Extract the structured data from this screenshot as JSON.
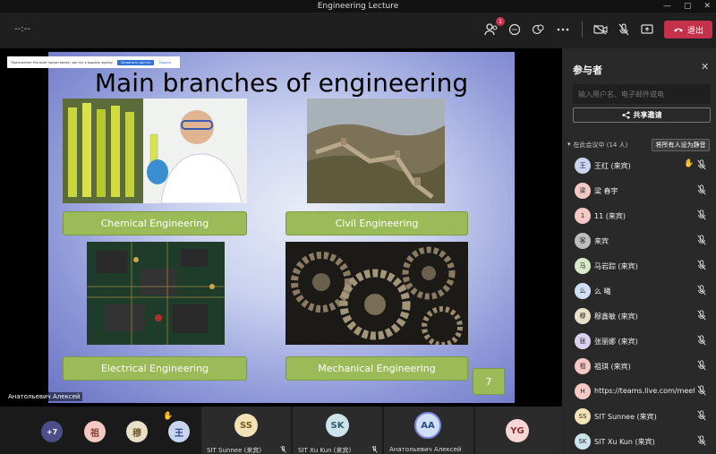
{
  "window": {
    "title": "Engineering Lecture",
    "min": "—",
    "max": "▢",
    "close": "✕"
  },
  "toolbar": {
    "timer": "--:--",
    "participants_badge": "1",
    "leave_label": "退出"
  },
  "notice": {
    "text": "Приложение Microsoft представляет доступ к вашему экрану",
    "button": "Запретить доступ",
    "link": "Скрыть"
  },
  "slide": {
    "title": "Main branches of engineering",
    "labels": [
      "Chemical Engineering",
      "Civil Engineering",
      "Electrical Engineering",
      "Mechanical Engineering"
    ],
    "page_number": "7"
  },
  "presenter": "Анатольевич Алексей",
  "strip": {
    "overflow": "+7",
    "avatars": [
      {
        "initials": "祖",
        "color": "#f4c9c4"
      },
      {
        "initials": "穆",
        "color": "#e8e0c8"
      },
      {
        "initials": "王",
        "color": "#c8d4f0"
      }
    ],
    "tiles": [
      {
        "initials": "SS",
        "name": "SIT Sunnee (来宾)",
        "color": "#f3e2b6"
      },
      {
        "initials": "SK",
        "name": "SIT Xu Kun (来宾)",
        "color": "#cde4ea"
      },
      {
        "initials": "AA",
        "name": "Анатольевич Алексей",
        "color": "#cfe0f6"
      },
      {
        "initials": "YG",
        "name": "",
        "color": "#f7d6d6"
      }
    ]
  },
  "panel": {
    "title": "参与者",
    "search_placeholder": "输入用户名、电子邮件或电",
    "share_label": "共享邀请",
    "in_meeting": "在此会议中 (14 人)",
    "mute_all": "将所有人设为静音",
    "participants": [
      {
        "initials": "王",
        "name": "王红 (来宾)",
        "color": "#c8d4f0",
        "hand": true
      },
      {
        "initials": "梁",
        "name": "梁 春宇",
        "color": "#f4c9c4",
        "hand": false
      },
      {
        "initials": "1",
        "name": "11 (来宾)",
        "color": "#f4c9c4",
        "hand": false
      },
      {
        "initials": "客",
        "name": "来宾",
        "color": "#bdbdbd",
        "hand": false
      },
      {
        "initials": "马",
        "name": "马岩踪 (来宾)",
        "color": "#d8e8c8",
        "hand": false
      },
      {
        "initials": "么",
        "name": "么 曦",
        "color": "#cfe0f6",
        "hand": false
      },
      {
        "initials": "穆",
        "name": "穆鑫敏 (来宾)",
        "color": "#e8e0c8",
        "hand": false
      },
      {
        "initials": "张",
        "name": "张丽娜 (来宾)",
        "color": "#dcd0f0",
        "hand": false
      },
      {
        "initials": "祖",
        "name": "祖琪 (来宾)",
        "color": "#f4c9c4",
        "hand": false
      },
      {
        "initials": "H",
        "name": "https://teams.live.com/meet/...",
        "color": "#f4c9c4",
        "hand": false
      },
      {
        "initials": "SS",
        "name": "SIT Sunnee (来宾)",
        "color": "#f3e2b6",
        "hand": false
      },
      {
        "initials": "SK",
        "name": "SIT Xu Kun (来宾)",
        "color": "#cde4ea",
        "hand": false
      }
    ]
  }
}
